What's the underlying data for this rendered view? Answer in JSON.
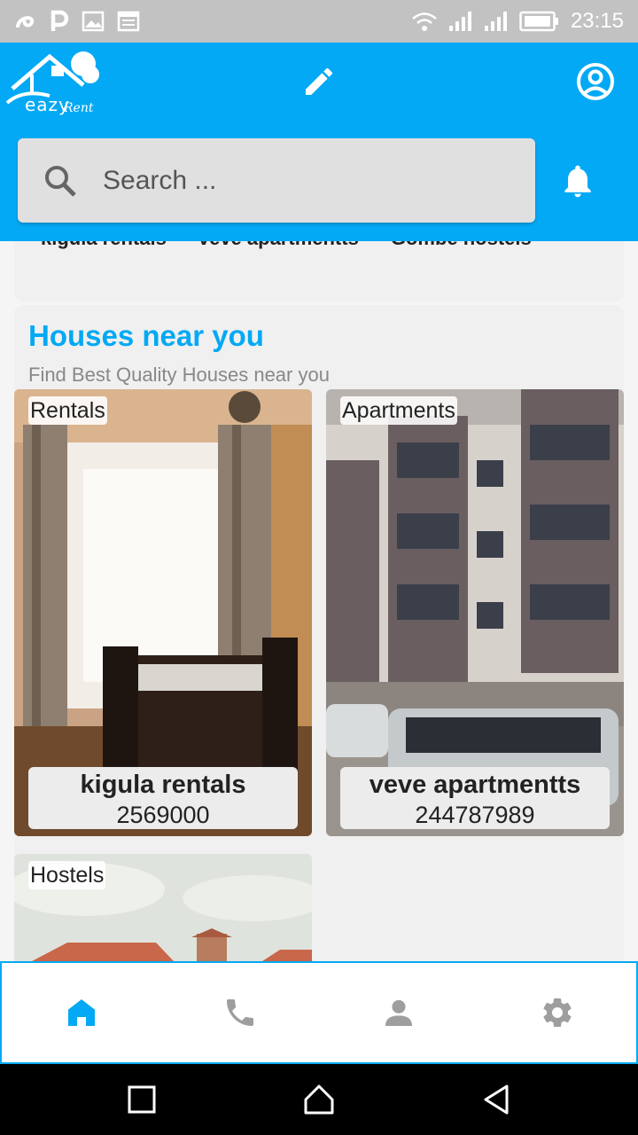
{
  "status_bar": {
    "time": "23:15",
    "icons": [
      "swirl-icon",
      "parking-icon",
      "image-icon",
      "calendar-icon",
      "wifi-icon",
      "signal-icon",
      "signal-icon",
      "battery-icon"
    ]
  },
  "app_bar": {
    "logo_text": "eazy",
    "logo_text2": "Rent",
    "search_placeholder": "Search ...",
    "color": "#03a9f4"
  },
  "top_strip": {
    "items": [
      "kigula rentals",
      "veve apartmentts",
      "Gombe hostels"
    ]
  },
  "section": {
    "title": "Houses near you",
    "subtitle": "Find Best Quality Houses  near you"
  },
  "cards": [
    {
      "category": "Rentals",
      "name": "kigula rentals",
      "phone": "2569000"
    },
    {
      "category": "Apartments",
      "name": "veve apartmentts",
      "phone": "244787989"
    },
    {
      "category": "Hostels"
    }
  ],
  "bottom_nav": {
    "items": [
      "home-icon",
      "phone-icon",
      "person-icon",
      "settings-icon"
    ],
    "active_color": "#03a9f4",
    "inactive_color": "#9e9e9e"
  },
  "system_nav": [
    "recents-icon",
    "home-outline-icon",
    "back-icon"
  ]
}
